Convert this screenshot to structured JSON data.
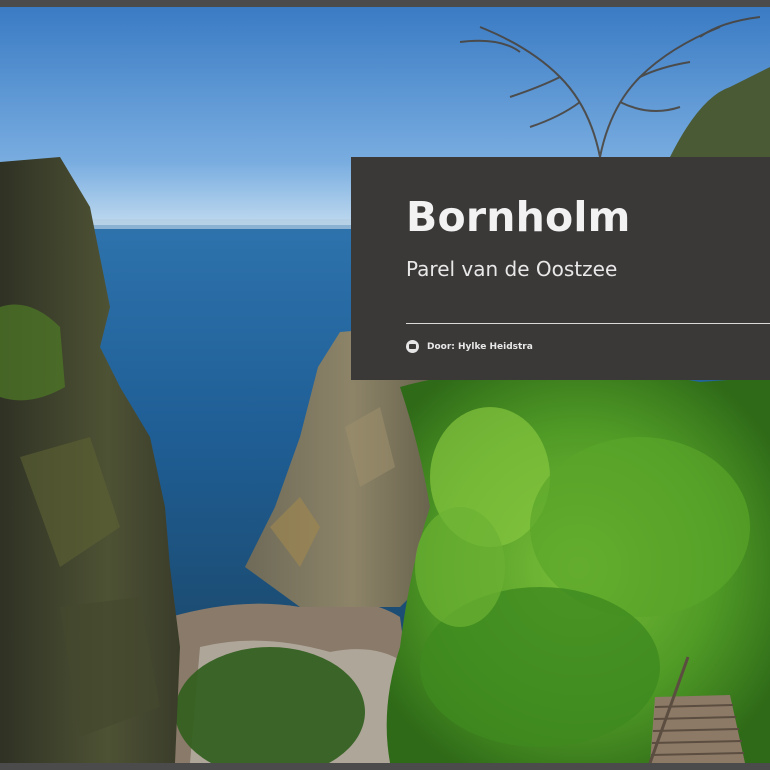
{
  "article": {
    "title": "Bornholm",
    "subtitle": "Parel van de Oostzee",
    "author": "Door: Hylke Heidstra",
    "author_icon": "camera-icon"
  },
  "colors": {
    "title_box_bg": "#3b3938",
    "title_text": "#f2f2f2",
    "frame": "#4b4b4b"
  }
}
